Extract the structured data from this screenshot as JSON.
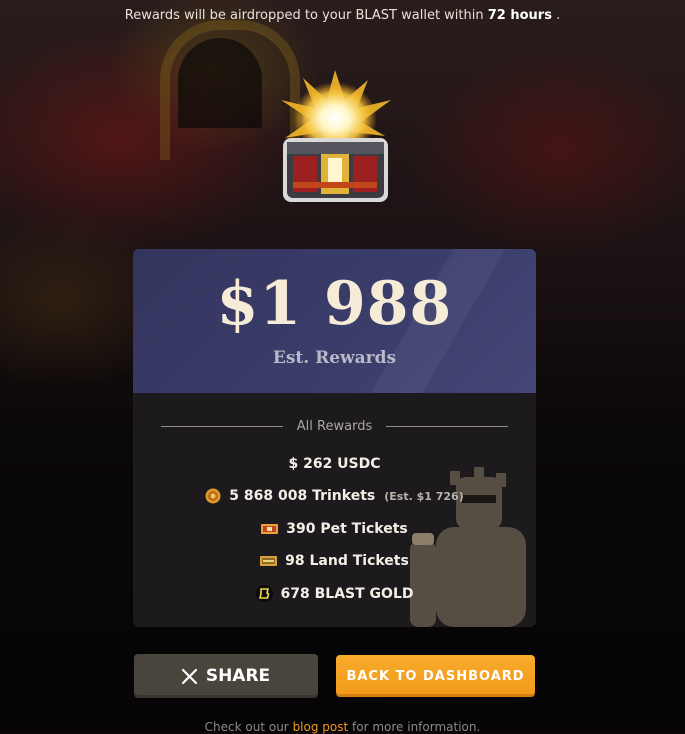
{
  "banner": {
    "prefix": "Rewards will be airdropped to your BLAST wallet within",
    "highlight": "72 hours",
    "suffix": "."
  },
  "card": {
    "amount": "$1 988",
    "amount_label": "Est. Rewards",
    "section_label": "All Rewards",
    "rewards": [
      {
        "icon": "none",
        "text": "$ 262 USDC",
        "note": ""
      },
      {
        "icon": "trinket-coin-icon",
        "text": "5 868 008 Trinkets",
        "note": "(Est. $1 726)"
      },
      {
        "icon": "pet-ticket-icon",
        "text": "390 Pet Tickets",
        "note": ""
      },
      {
        "icon": "land-ticket-icon",
        "text": "98 Land Tickets",
        "note": ""
      },
      {
        "icon": "blast-gold-icon",
        "text": "678 BLAST GOLD",
        "note": ""
      }
    ]
  },
  "actions": {
    "share_label": "SHARE",
    "back_label": "BACK TO DASHBOARD"
  },
  "footer": {
    "prefix": "Check out our",
    "link": "blog post",
    "suffix": "for more information."
  },
  "colors": {
    "accent": "#f29a1a",
    "card_header": "#3a3c6a",
    "share_button": "#4a453c"
  }
}
